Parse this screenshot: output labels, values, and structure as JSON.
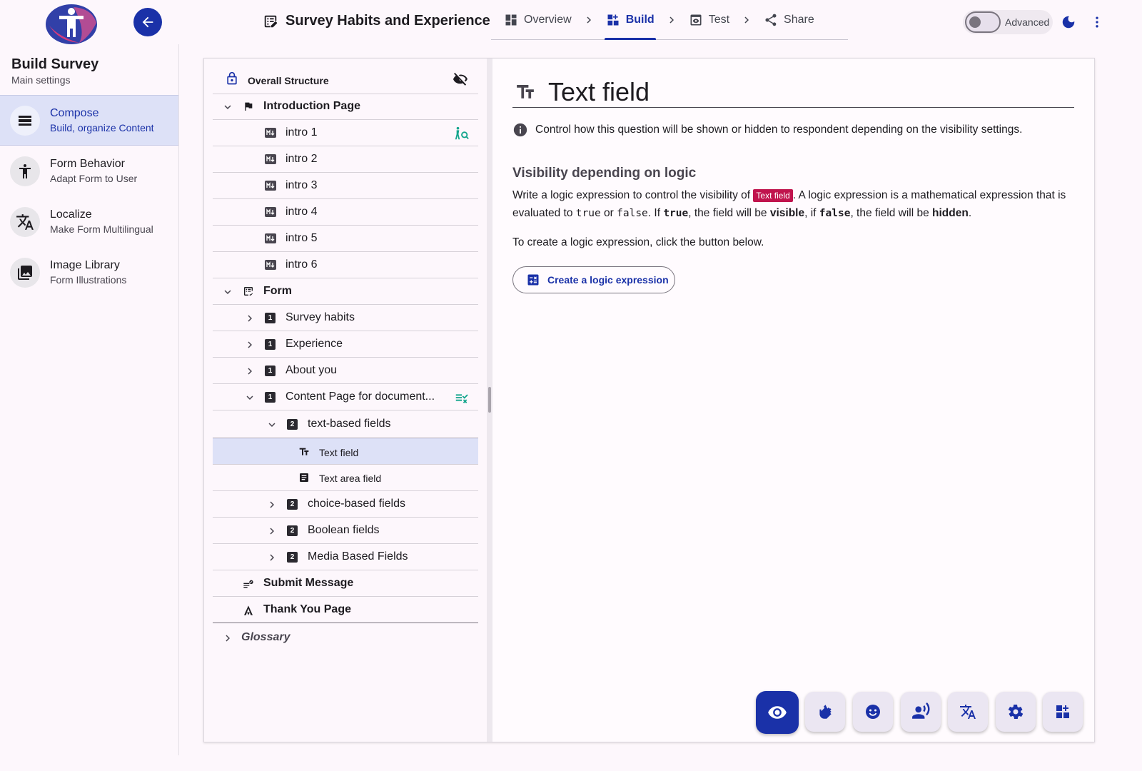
{
  "header": {
    "survey_title": "Survey Habits and Experience",
    "steps": [
      {
        "label": "Overview",
        "icon": "dashboard-icon"
      },
      {
        "label": "Build",
        "icon": "build-icon",
        "active": true
      },
      {
        "label": "Test",
        "icon": "preview-icon"
      },
      {
        "label": "Share",
        "icon": "share-icon"
      }
    ],
    "advanced_label": "Advanced",
    "advanced_on": false
  },
  "sidebar": {
    "title": "Build Survey",
    "subtitle": "Main settings",
    "items": [
      {
        "title": "Compose",
        "subtitle": "Build, organize Content",
        "icon": "compose-icon",
        "active": true
      },
      {
        "title": "Form Behavior",
        "subtitle": "Adapt Form to User",
        "icon": "accessibility-icon"
      },
      {
        "title": "Localize",
        "subtitle": "Make Form Multilingual",
        "icon": "translate-icon"
      },
      {
        "title": "Image Library",
        "subtitle": "Form Illustrations",
        "icon": "image-library-icon"
      }
    ]
  },
  "tree": {
    "header": "Overall Structure",
    "intro_page": "Introduction Page",
    "intro_items": [
      "intro 1",
      "intro 2",
      "intro 3",
      "intro 4",
      "intro 5",
      "intro 6"
    ],
    "form": "Form",
    "form_pages": [
      "Survey habits",
      "Experience",
      "About you",
      "Content Page for document..."
    ],
    "page_badge": "1",
    "group_badge": "2",
    "text_group": "text-based fields",
    "text_fields": [
      "Text field",
      "Text area field"
    ],
    "other_groups": [
      "choice-based fields",
      "Boolean fields",
      "Media Based Fields"
    ],
    "submit": "Submit Message",
    "thank_you": "Thank You Page",
    "glossary": "Glossary"
  },
  "detail": {
    "title": "Text field",
    "info": "Control how this question will be shown or hidden to respondent depending on the visibility settings.",
    "section_title": "Visibility depending on logic",
    "para_1": "Write a logic expression to control the visibility of",
    "field_tag": "Text field",
    "para_2": ". A logic expression is a mathematical expression that is evaluated to",
    "code_true": "true",
    "para_or": "or",
    "code_false": "false",
    "para_3": ". If",
    "para_4": ", the field will be",
    "visible": "visible",
    "para_5": ", if",
    "para_6": ", the field will be",
    "hidden": "hidden",
    "para_end": ".",
    "para_create": "To create a logic expression, click the button below.",
    "button": "Create a logic expression"
  },
  "fabs": [
    "visibility-icon",
    "sign-language-icon",
    "emoji-icon",
    "voice-icon",
    "translate-icon",
    "settings-icon",
    "add-widget-icon"
  ],
  "colors": {
    "accent": "#1a31a8",
    "selected_bg": "#dde1f7",
    "tag": "#c0134d",
    "teal": "#12a58c"
  }
}
